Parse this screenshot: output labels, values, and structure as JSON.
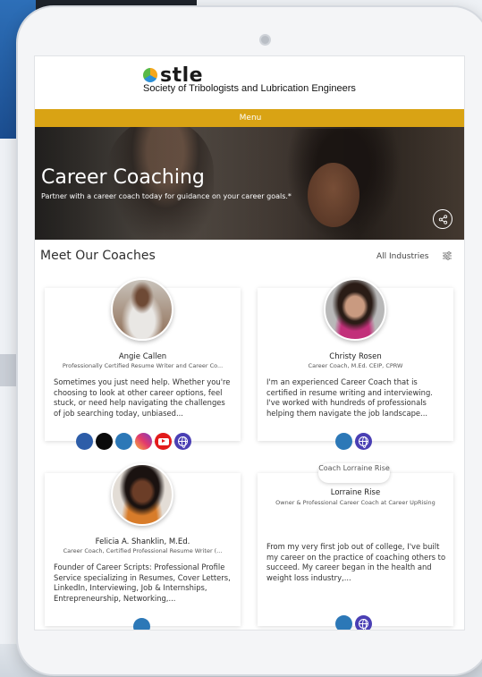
{
  "brand": {
    "logo_text": "stle",
    "org_name": "Society of Tribologists and Lubrication Engineers"
  },
  "nav": {
    "menu_label": "Menu"
  },
  "hero": {
    "title": "Career Coaching",
    "subtitle": "Partner with a career coach today for guidance on your career goals.*"
  },
  "coaches_section": {
    "heading": "Meet Our Coaches",
    "filter_label": "All Industries"
  },
  "coaches": [
    {
      "name": "Angie Callen",
      "title": "Professionally Certified Resume Writer and Career Co...",
      "description": "Sometimes you just need help. Whether you're choosing to look at other career options, feel stuck, or need help navigating the challenges of job searching today, unbiased...",
      "social": [
        "facebook-icon",
        "x-icon",
        "linkedin-icon",
        "instagram-icon",
        "youtube-icon",
        "website-icon"
      ]
    },
    {
      "name": "Christy Rosen",
      "title": "Career Coach, M.Ed. CEIP, CPRW",
      "description": "I'm an experienced Career Coach that is certified in resume writing and interviewing. I've worked with hundreds of professionals helping them navigate the job landscape...",
      "social": [
        "linkedin-icon",
        "website-icon"
      ]
    },
    {
      "name": "Felicia A. Shanklin, M.Ed.",
      "title": "Career Coach, Certified Professional Resume Writer (...",
      "description": "Founder of Career Scripts: Professional Profile Service specializing in Resumes, Cover Letters, LinkedIn, Interviewing, Job & Internships, Entrepreneurship, Networking,...",
      "social": [
        "linkedin-icon"
      ]
    },
    {
      "name": "Lorraine Rise",
      "image_alt": "Coach Lorraine Rise",
      "title": "Owner & Professional Career Coach at Career UpRising",
      "description": "From my very first job out of college, I've built my career on the practice of coaching others to succeed. My career began in the health and weight loss industry,...",
      "social": [
        "linkedin-icon",
        "website-icon"
      ]
    }
  ],
  "colors": {
    "menu_bar": "#d9a314",
    "facebook": "#2d5da8",
    "linkedin": "#2c78b7",
    "youtube": "#e21b1b",
    "website": "#4a3fb4"
  }
}
